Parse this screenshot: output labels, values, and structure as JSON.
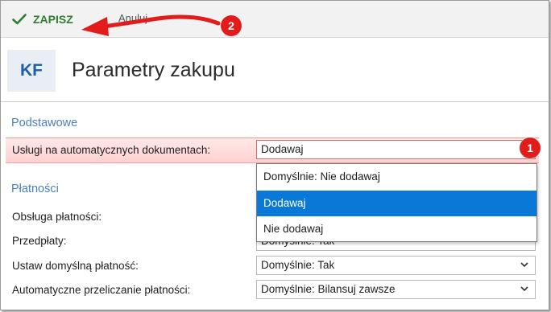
{
  "toolbar": {
    "save_label": "ZAPISZ",
    "cancel_label": "Anuluj",
    "save_color": "#2e7d32"
  },
  "header": {
    "avatar_initials": "KF",
    "title": "Parametry zakupu",
    "avatar_color": "#1f5fa5"
  },
  "sections": {
    "basic": {
      "title": "Podstawowe",
      "field_label": "Usługi na automatycznych dokumentach:",
      "field_value": "Dodawaj"
    },
    "payments": {
      "title": "Płatności",
      "fields": [
        {
          "label": "Obsługa płatności:",
          "value": ""
        },
        {
          "label": "Przedpłaty:",
          "value": "Domyślnie: Tak"
        },
        {
          "label": "Ustaw domyślną płatność:",
          "value": "Domyślnie: Tak"
        },
        {
          "label": "Automatyczne przeliczanie płatności:",
          "value": "Domyślnie: Bilansuj zawsze"
        }
      ]
    }
  },
  "dropdown": {
    "options": [
      "Domyślnie: Nie dodawaj",
      "Dodawaj",
      "Nie dodawaj"
    ],
    "selected_index": 1,
    "highlight_color": "#0a78d7"
  },
  "annotations": {
    "badge_1": "1",
    "badge_2": "2",
    "color": "#e41b1b"
  },
  "icons": {
    "save": "checkmark-icon",
    "select": "chevron-down-icon"
  }
}
